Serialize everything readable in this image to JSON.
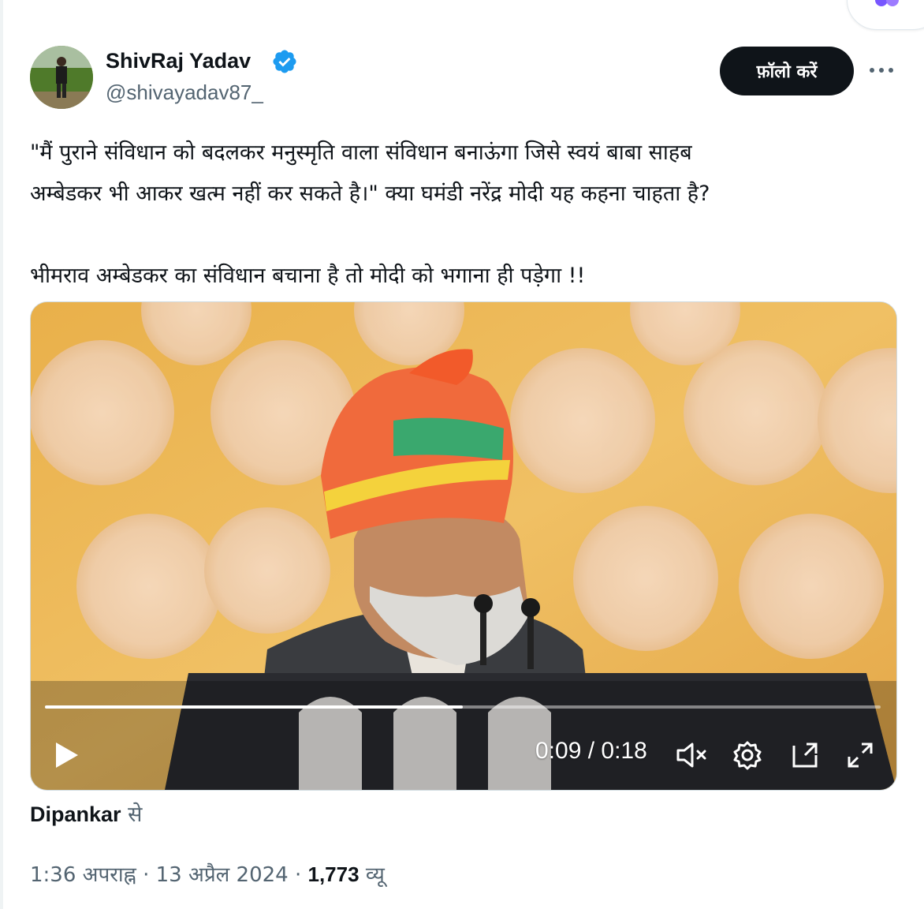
{
  "author": {
    "display_name": "ShivRaj Yadav",
    "handle": "@shivayadav87_",
    "verified": true
  },
  "follow_button_label": "फ़ॉलो करें",
  "tweet": {
    "line1": "\"मैं पुराने संविधान को बदलकर मनुस्मृति वाला संविधान बनाऊंगा जिसे स्वयं बाबा साहब",
    "line2": "अम्बेडकर भी आकर खत्म नहीं कर सकते है।\" क्या घमंडी नरेंद्र मोदी यह कहना चाहता है?",
    "line3": "भीमराव अम्बेडकर का संविधान बचाना है तो मोदी को भगाना ही पड़ेगा !!"
  },
  "video": {
    "time_display": "0:09 / 0:18",
    "progress": 0.5,
    "muted": true
  },
  "attribution": {
    "source": "Dipankar",
    "suffix": "से"
  },
  "meta": {
    "time": "1:36 अपराह्न",
    "separator": "·",
    "date": "13 अप्रैल 2024",
    "views_count": "1,773",
    "views_label": "व्यू"
  },
  "colors": {
    "accent_verified": "#1d9bf0",
    "text_primary": "#0f1419",
    "text_secondary": "#536471"
  }
}
